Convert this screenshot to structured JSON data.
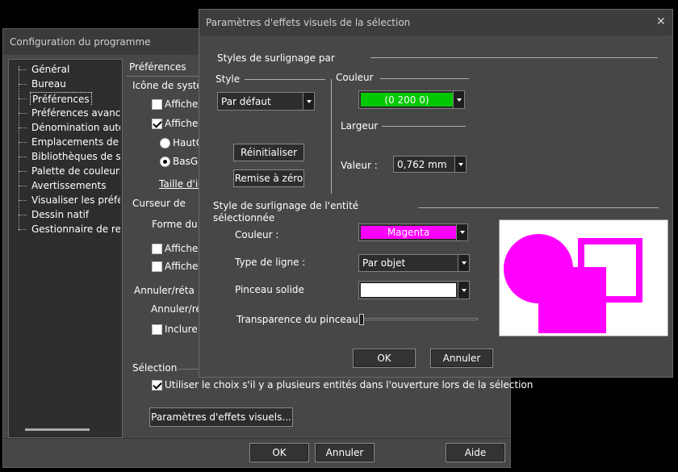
{
  "config_window": {
    "title": "Configuration du programme",
    "tree_items": [
      "Général",
      "Bureau",
      "Préférences",
      "Préférences avancées",
      "Dénomination autom",
      "Emplacements de fic",
      "Bibliothèques de sym",
      "Palette de couleurs",
      "Avertissements",
      "Visualiser les préférer",
      "Dessin natif",
      "Gestionnaire de rend"
    ],
    "selected_tree_item": "Préférences",
    "panel_heading": "Préférences",
    "icon_group_label": "Icône de systèm",
    "afficher_1": "Afficher",
    "afficher_2": "Afficher",
    "radio_top": "HautG",
    "radio_bottom": "BasGa",
    "taille_label": "Taille d'ic",
    "cursor_label": "Curseur de",
    "forme_label": "Forme du c",
    "afficher_3": "Afficher",
    "afficher_4": "Afficher",
    "undo_group_label": "Annuler/réta",
    "undo_sub_label": "Annuler/rét",
    "inclure_label": "Inclure l",
    "selection_label": "Sélection",
    "selection_checkbox_label": "Utiliser le choix s'il y a plusieurs entités dans l'ouverture lors de la sélection",
    "visual_effects_button": "Paramètres d'effets visuels...",
    "ok_button": "OK",
    "cancel_button": "Annuler",
    "help_button": "Aide"
  },
  "dialog": {
    "title": "Paramètres d'effets visuels de la sélection",
    "close_glyph": "✕",
    "highlight_group_label": "Styles de surlignage par",
    "style_label": "Style",
    "style_value": "Par défaut",
    "reset_button": "Réinitialiser",
    "zero_button": "Remise à zéro",
    "color_label": "Couleur",
    "color_value": "(0 200 0)",
    "color_swatch": "#00c800",
    "width_label": "Largeur",
    "value_label": "Valeur :",
    "value_value": "0,762 mm",
    "entity_group_label_line1": "Style de surlignage de l'entité",
    "entity_group_label_line2": "sélectionnée",
    "entity_color_label": "Couleur :",
    "entity_color_value": "Magenta",
    "entity_color_swatch": "#ff00ff",
    "line_type_label": "Type de ligne :",
    "line_type_value": "Par objet",
    "brush_label": "Pinceau solide",
    "transparency_label": "Transparence du pinceau :",
    "transparency_value": 0,
    "ok_button": "OK",
    "cancel_button": "Annuler"
  }
}
